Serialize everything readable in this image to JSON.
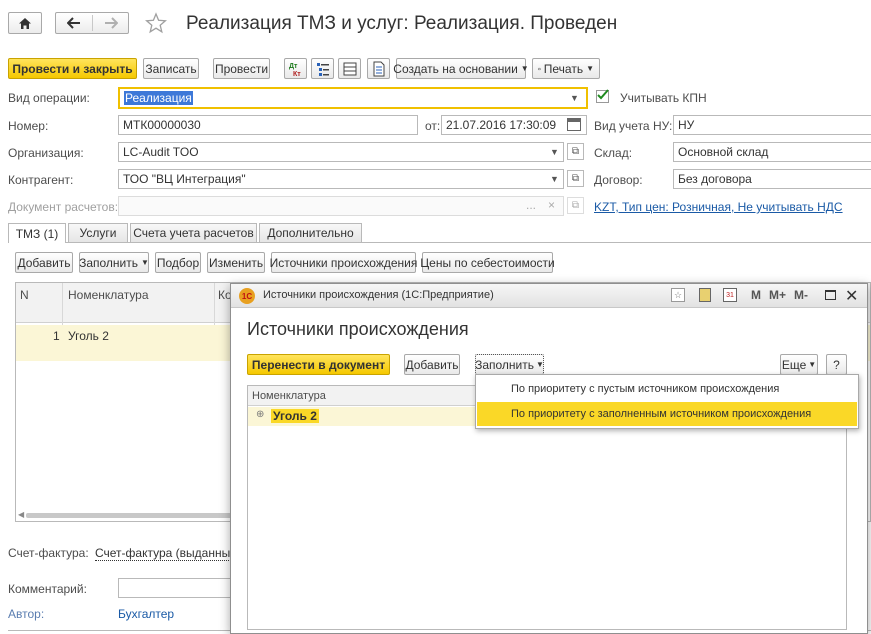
{
  "window": {
    "title": "Реализация ТМЗ и услуг: Реализация. Проведен"
  },
  "toolbar": {
    "post_close_label": "Провести и закрыть",
    "save_label": "Записать",
    "post_label": "Провести",
    "dt_kt_glyph": "Дт\nКт",
    "create_based_label": "Создать на основании",
    "print_label": "Печать"
  },
  "form": {
    "operation_label": "Вид операции:",
    "operation_value": "Реализация",
    "vat_checkbox_label": "Учитывать КПН",
    "vat_checked": true,
    "number_label": "Номер:",
    "number_value": "МТК00000030",
    "date_label": "от:",
    "date_value": "21.07.2016 17:30:09",
    "tax_type_label": "Вид учета НУ:",
    "tax_type_value": "НУ",
    "org_label": "Организация:",
    "org_value": "LC-Audit TOO",
    "warehouse_label": "Склад:",
    "warehouse_value": "Основной склад",
    "counterparty_label": "Контрагент:",
    "counterparty_value": "ТОО \"ВЦ Интеграция\"",
    "contract_label": "Договор:",
    "contract_value": "Без договора",
    "settlement_doc_label": "Документ расчетов:",
    "settlement_doc_value": "",
    "price_link": "KZT, Тип цен: Розничная, Не учитывать НДС"
  },
  "tabs": [
    {
      "label": "ТМЗ (1)",
      "active": true
    },
    {
      "label": "Услуги",
      "active": false
    },
    {
      "label": "Счета учета расчетов",
      "active": false
    },
    {
      "label": "Дополнительно",
      "active": false
    }
  ],
  "table_toolbar": {
    "add_label": "Добавить",
    "fill_label": "Заполнить",
    "select_label": "Подбор",
    "change_label": "Изменить",
    "sources_label": "Источники происхождения",
    "cost_prices_label": "Цены по себестоимости"
  },
  "table": {
    "columns": [
      "N",
      "Номенклатура",
      "Ко"
    ],
    "rows": [
      {
        "n": "1",
        "item": "Уголь 2"
      }
    ]
  },
  "footer": {
    "invoice_label": "Счет-фактура:",
    "invoice_link": "Счет-фактура (выданный)",
    "comment_label": "Комментарий:",
    "comment_value": "",
    "author_label": "Автор:",
    "author_value": "Бухгалтер"
  },
  "dialog": {
    "window_title": "Источники происхождения  (1С:Предприятие)",
    "heading": "Источники происхождения",
    "transfer_label": "Перенести в документ",
    "add_label": "Добавить",
    "fill_label": "Заполнить",
    "more_label": "Еще",
    "help_label": "?",
    "column_header": "Номенклатура",
    "row_item": "Уголь 2",
    "title_buttons": {
      "m": "M",
      "m_plus": "M+",
      "m_minus": "M-"
    }
  },
  "fill_menu": {
    "items": [
      {
        "label": "По приоритету с пустым источником происхождения",
        "highlighted": false
      },
      {
        "label": "По приоритету с заполненным источником происхождения",
        "highlighted": true
      }
    ]
  },
  "colors": {
    "accent_yellow": "#f5c800",
    "row_highlight": "#fbf6d6",
    "menu_highlight": "#fad827",
    "link": "#1a5aa6"
  }
}
